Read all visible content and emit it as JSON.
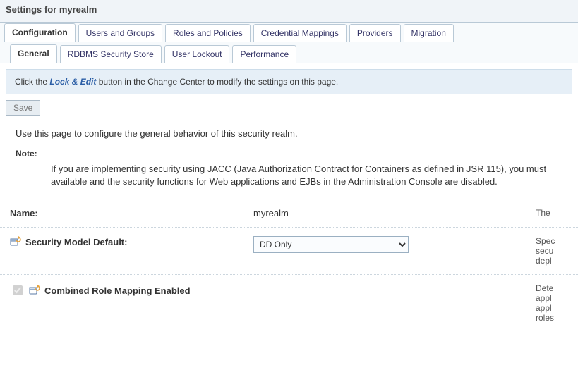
{
  "page_title": "Settings for myrealm",
  "tabs_primary": {
    "items": [
      {
        "label": "Configuration",
        "active": true
      },
      {
        "label": "Users and Groups"
      },
      {
        "label": "Roles and Policies"
      },
      {
        "label": "Credential Mappings"
      },
      {
        "label": "Providers"
      },
      {
        "label": "Migration"
      }
    ]
  },
  "tabs_secondary": {
    "items": [
      {
        "label": "General",
        "active": true
      },
      {
        "label": "RDBMS Security Store"
      },
      {
        "label": "User Lockout"
      },
      {
        "label": "Performance"
      }
    ]
  },
  "info_bar": {
    "prefix": "Click the ",
    "lock_edit": "Lock & Edit",
    "suffix": " button in the Change Center to modify the settings on this page."
  },
  "save_button": "Save",
  "intro": "Use this page to configure the general behavior of this security realm.",
  "note_label": "Note:",
  "note_body": "If you are implementing security using JACC (Java Authorization Contract for Containers as defined in JSR 115), you must available and the security functions for Web applications and EJBs in the Administration Console are disabled.",
  "fields": {
    "name": {
      "label": "Name:",
      "value": "myrealm",
      "desc": "The"
    },
    "security_model": {
      "label": "Security Model Default:",
      "selected": "DD Only",
      "desc1": "Spec",
      "desc2": "secu",
      "desc3": "depl"
    },
    "combined_role": {
      "label": "Combined Role Mapping Enabled",
      "checked": true,
      "desc1": "Dete",
      "desc2": "appl",
      "desc3": "appl",
      "desc4": "roles"
    }
  }
}
